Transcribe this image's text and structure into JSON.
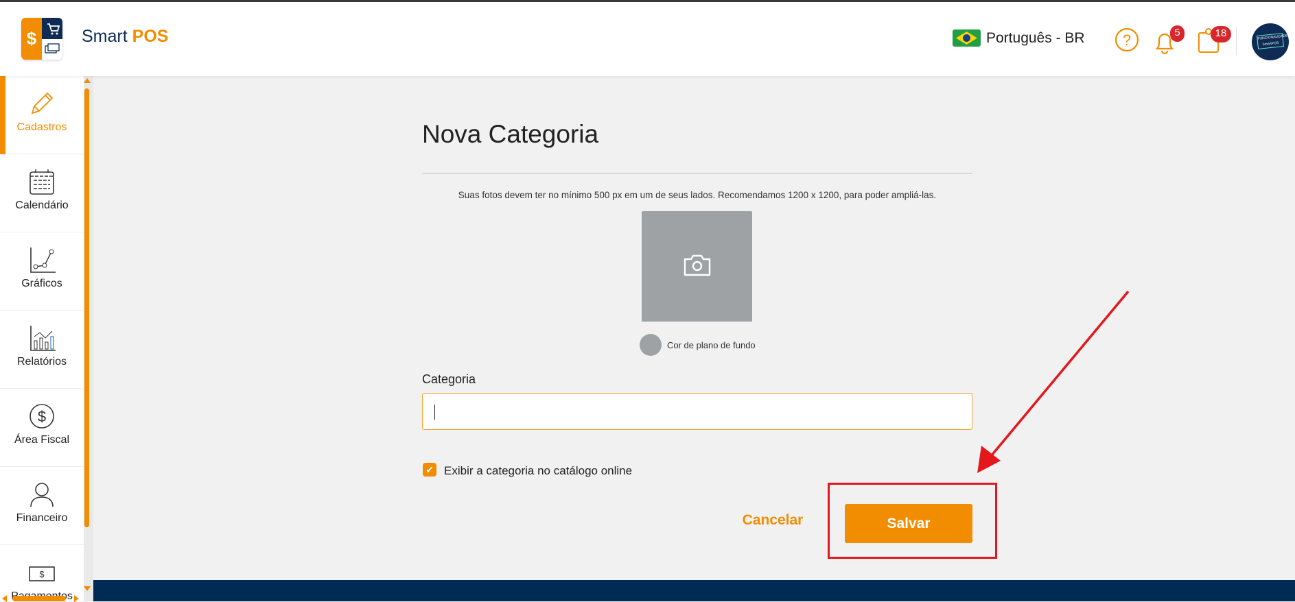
{
  "header": {
    "brand_smart": "Smart",
    "brand_pos": "POS",
    "language": "Português - BR",
    "notifications_count": "5",
    "tasks_count": "18",
    "avatar_text": "FUNCIONALIDADE SmartPOS"
  },
  "sidebar": {
    "items": [
      {
        "label": "Cadastros",
        "icon": "pencil-icon",
        "active": true
      },
      {
        "label": "Calendário",
        "icon": "calendar-icon"
      },
      {
        "label": "Gráficos",
        "icon": "line-chart-icon"
      },
      {
        "label": "Relatórios",
        "icon": "bar-chart-icon"
      },
      {
        "label": "Área Fiscal",
        "icon": "dollar-circle-icon"
      },
      {
        "label": "Financeiro",
        "icon": "person-icon"
      },
      {
        "label": "Pagamentos",
        "icon": "banknote-icon"
      }
    ]
  },
  "form": {
    "title": "Nova Categoria",
    "photo_hint": "Suas fotos devem ter no mínimo 500 px em um de seus lados. Recomendamos 1200 x 1200, para poder ampliá-las.",
    "bg_color_label": "Cor de plano de fundo",
    "category_label": "Categoria",
    "category_value": "",
    "show_online_label": "Exibir a categoria no catálogo online",
    "show_online_checked": true,
    "cancel_label": "Cancelar",
    "save_label": "Salvar"
  },
  "colors": {
    "accent": "#f28c00",
    "navy": "#002b55",
    "annotation": "#e3171c"
  }
}
